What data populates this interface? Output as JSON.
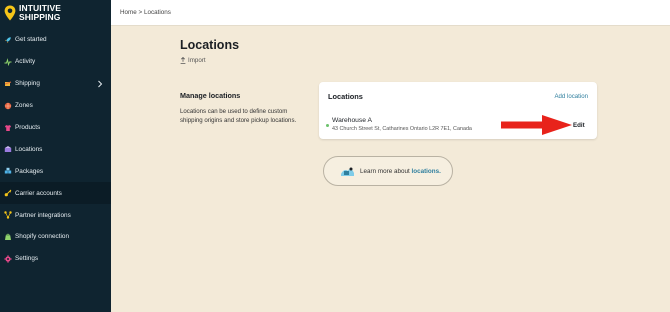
{
  "brand": {
    "line1": "INTUITIVE",
    "line2": "SHIPPING"
  },
  "sidebar": {
    "items": [
      {
        "label": "Get started",
        "icon": "rocket-icon"
      },
      {
        "label": "Activity",
        "icon": "activity-icon"
      },
      {
        "label": "Shipping",
        "icon": "shipping-icon",
        "has_submenu": true
      },
      {
        "label": "Zones",
        "icon": "zones-icon"
      },
      {
        "label": "Products",
        "icon": "products-icon"
      },
      {
        "label": "Locations",
        "icon": "locations-icon"
      },
      {
        "label": "Packages",
        "icon": "packages-icon"
      },
      {
        "label": "Carrier accounts",
        "icon": "key-icon",
        "active": true
      },
      {
        "label": "Partner integrations",
        "icon": "integrations-icon"
      },
      {
        "label": "Shopify connection",
        "icon": "shopify-icon"
      },
      {
        "label": "Settings",
        "icon": "gear-icon"
      }
    ]
  },
  "breadcrumb": {
    "home": "Home",
    "separator": ">",
    "current": "Locations"
  },
  "page": {
    "title": "Locations",
    "import_label": "Import"
  },
  "manage": {
    "title": "Manage locations",
    "description": "Locations can be used to define custom shipping origins and store pickup locations."
  },
  "card": {
    "title": "Locations",
    "add_label": "Add location",
    "location": {
      "name": "Warehouse A",
      "address": "43 Church Street St, Catharines Ontario L2R 7E1, Canada",
      "edit_label": "Edit"
    }
  },
  "learn_more": {
    "prefix": "Learn more about",
    "link": "locations."
  },
  "colors": {
    "sidebar_bg": "#0f2430",
    "page_bg": "#f3ead8",
    "accent": "#2f7f9e",
    "logo_yellow": "#f5c518",
    "arrow_red": "#e8231b",
    "status_green": "#6cc26c"
  }
}
